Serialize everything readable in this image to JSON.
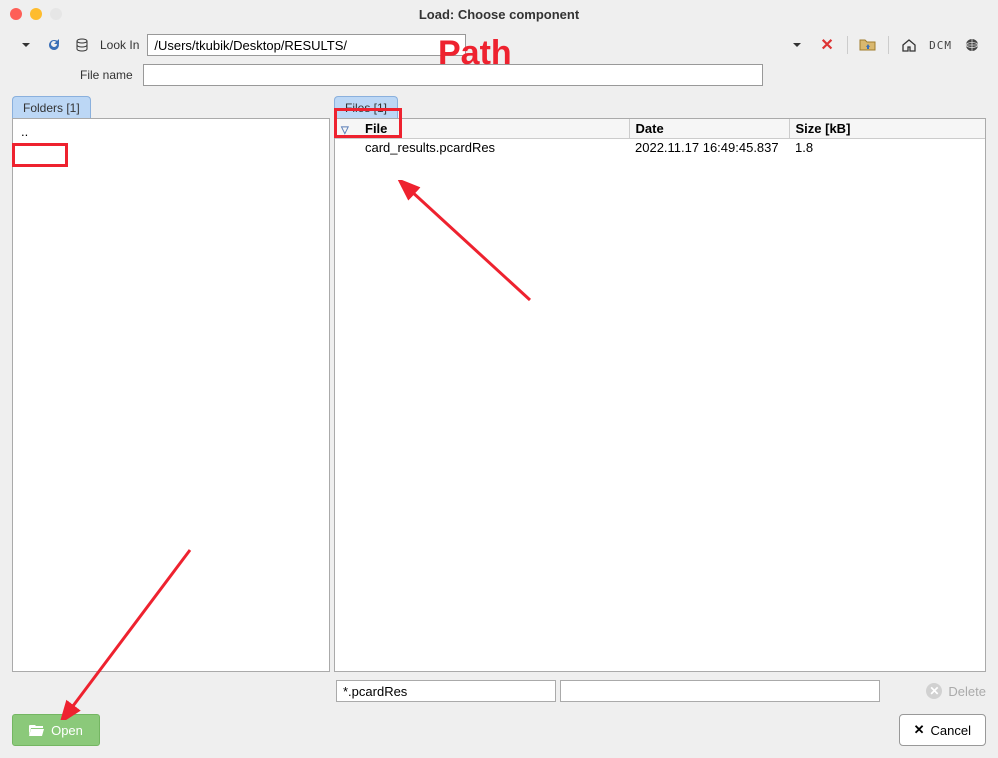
{
  "window": {
    "title": "Load: Choose component"
  },
  "toolbar": {
    "lookin_label": "Look In",
    "path": "/Users/tkubik/Desktop/RESULTS/"
  },
  "filename": {
    "label": "File name",
    "value": ""
  },
  "folders": {
    "tab_label": "Folders [1]",
    "items": [
      ".."
    ]
  },
  "files": {
    "tab_label": "Files [1]",
    "columns": {
      "file": "File",
      "date": "Date",
      "size": "Size [kB]"
    },
    "rows": [
      {
        "file": "card_results.pcardRes",
        "date": "2022.11.17 16:49:45.837",
        "size": "1.8"
      }
    ]
  },
  "filter": {
    "pattern": "*.pcardRes",
    "search": ""
  },
  "actions": {
    "open": "Open",
    "cancel": "Cancel",
    "delete": "Delete"
  },
  "icons": {
    "dcm": "DCM"
  },
  "annotations": {
    "path_label": "Path"
  }
}
